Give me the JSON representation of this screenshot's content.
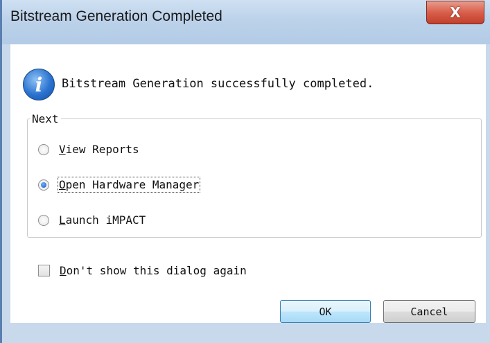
{
  "window": {
    "title": "Bitstream Generation Completed",
    "close_glyph": "X"
  },
  "message": {
    "icon": "info-icon",
    "text": "Bitstream Generation successfully completed."
  },
  "next_group": {
    "label": "Next",
    "options": [
      {
        "accel": "V",
        "rest": "iew Reports",
        "selected": false
      },
      {
        "accel": "O",
        "rest": "pen Hardware Manager",
        "selected": true
      },
      {
        "accel": "L",
        "rest": "aunch iMPACT",
        "selected": false
      }
    ]
  },
  "dont_show": {
    "accel": "D",
    "rest": "on't show this dialog again",
    "checked": false
  },
  "buttons": {
    "ok": "OK",
    "cancel": "Cancel"
  },
  "colors": {
    "accent": "#2a73d0",
    "close_button": "#d85f4b",
    "frame": "#c8d9ec"
  }
}
